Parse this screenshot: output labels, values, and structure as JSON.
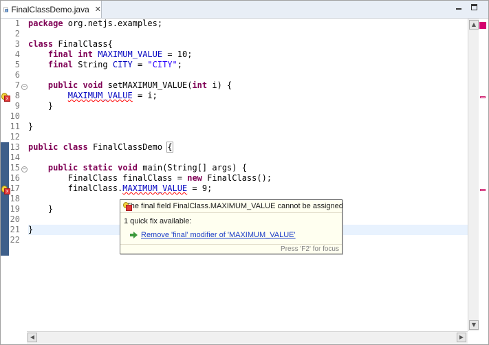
{
  "editor": {
    "tab_title": "FinalClassDemo.java",
    "close_glyph": "✕",
    "tab_icon": "java-file-icon"
  },
  "line_numbers": [
    "1",
    "2",
    "3",
    "4",
    "5",
    "6",
    "7",
    "8",
    "9",
    "10",
    "11",
    "12",
    "13",
    "14",
    "15",
    "16",
    "17",
    "18",
    "19",
    "20",
    "21",
    "22"
  ],
  "code": {
    "l1_kw": "package",
    "l1_rest": " org.netjs.examples;",
    "l3_kw": "class",
    "l3_rest": " FinalClass{",
    "l4_indent": "    ",
    "l4_kw1": "final",
    "l4_sp": " ",
    "l4_kw2": "int",
    "l4_sp2": " ",
    "l4_field": "MAXIMUM_VALUE",
    "l4_rest": " = 10;",
    "l5_indent": "    ",
    "l5_kw": "final",
    "l5_mid": " String ",
    "l5_field": "CITY",
    "l5_eq": " = ",
    "l5_str": "\"CITY\"",
    "l5_end": ";",
    "l7_indent": "    ",
    "l7_kw1": "public",
    "l7_sp": " ",
    "l7_kw2": "void",
    "l7_mid": " setMAXIMUM_VALUE(",
    "l7_kw3": "int",
    "l7_rest": " i) {",
    "l8_indent": "        ",
    "l8_field": "MAXIMUM_VALUE",
    "l8_rest": " = i;",
    "l9_text": "    }",
    "l11_text": "}",
    "l13_kw1": "public",
    "l13_sp": " ",
    "l13_kw2": "class",
    "l13_mid": " FinalClassDemo ",
    "l13_brace": "{",
    "l15_indent": "    ",
    "l15_kw1": "public",
    "l15_sp1": " ",
    "l15_kw2": "static",
    "l15_sp2": " ",
    "l15_kw3": "void",
    "l15_rest": " main(String[] args) {",
    "l16_indent": "        ",
    "l16_a": "FinalClass ",
    "l16_var": "finalClass",
    "l16_eq": " = ",
    "l16_kw": "new",
    "l16_rest": " FinalClass();",
    "l17_indent": "        ",
    "l17_a": "finalClass.",
    "l17_field": "MAXIMUM_VALUE",
    "l17_rest": " = 9;",
    "l19_text": "    }",
    "l21_text": "}"
  },
  "popup": {
    "message": "The final field FinalClass.MAXIMUM_VALUE cannot be assigned",
    "quick_fix_count": "1 quick fix available:",
    "fix_label": "Remove 'final' modifier of 'MAXIMUM_VALUE'",
    "focus_hint": "Press 'F2' for focus"
  },
  "scroll": {
    "up_glyph": "▲",
    "down_glyph": "▼",
    "left_glyph": "◀",
    "right_glyph": "▶"
  },
  "colors": {
    "keyword": "#7f0055",
    "field": "#0000c0",
    "string": "#2a00ff",
    "error": "#d4006d"
  }
}
